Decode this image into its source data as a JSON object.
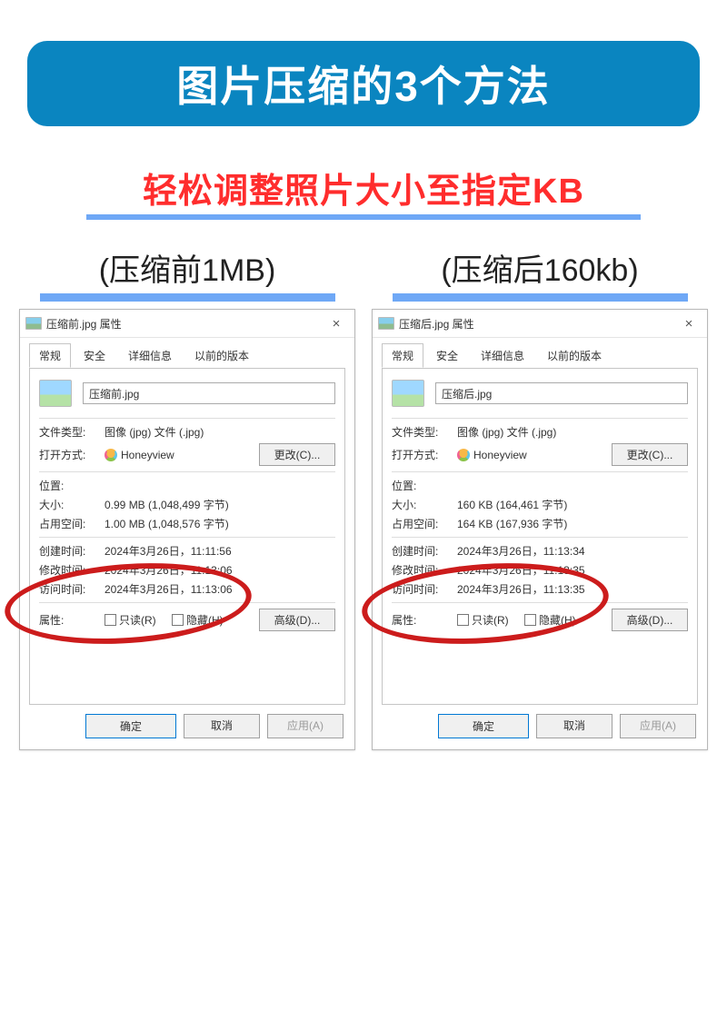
{
  "banner_title": "图片压缩的3个方法",
  "subtitle": "轻松调整照片大小至指定KB",
  "cols": {
    "left": {
      "label": "(压缩前1MB)"
    },
    "right": {
      "label": "(压缩后160kb)"
    }
  },
  "tabs": {
    "general": "常规",
    "security": "安全",
    "details": "详细信息",
    "previous": "以前的版本"
  },
  "labels": {
    "file_type": "文件类型:",
    "open_with": "打开方式:",
    "location": "位置:",
    "size": "大小:",
    "size_on_disk": "占用空间:",
    "created": "创建时间:",
    "modified": "修改时间:",
    "accessed": "访问时间:",
    "attributes": "属性:",
    "readonly": "只读(R)",
    "hidden": "隐藏(H)",
    "change": "更改(C)...",
    "advanced": "高级(D)...",
    "ok": "确定",
    "cancel": "取消",
    "apply": "应用(A)"
  },
  "common": {
    "file_type_value": "图像 (jpg) 文件 (.jpg)",
    "open_with_value": "Honeyview"
  },
  "dialog_left": {
    "title": "压缩前.jpg 属性",
    "filename": "压缩前.jpg",
    "size": "0.99 MB (1,048,499 字节)",
    "size_on_disk": "1.00 MB (1,048,576 字节)",
    "created": "2024年3月26日，11:11:56",
    "modified": "2024年3月26日，11:13:06",
    "accessed": "2024年3月26日，11:13:06"
  },
  "dialog_right": {
    "title": "压缩后.jpg 属性",
    "filename": "压缩后.jpg",
    "size": "160 KB (164,461 字节)",
    "size_on_disk": "164 KB (167,936 字节)",
    "created": "2024年3月26日，11:13:34",
    "modified": "2024年3月26日，11:13:35",
    "accessed": "2024年3月26日，11:13:35"
  }
}
